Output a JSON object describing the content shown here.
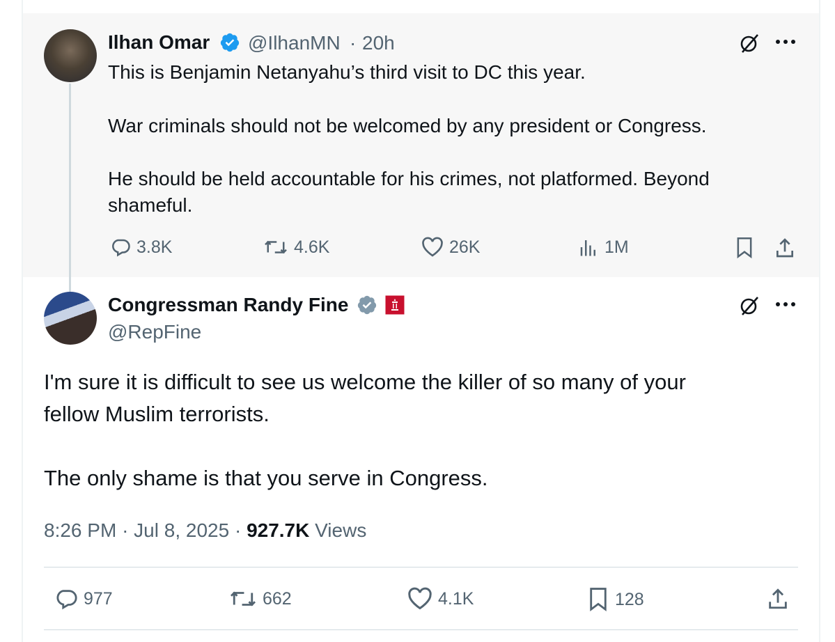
{
  "parent_tweet": {
    "author_name": "Ilhan Omar",
    "handle": "@IlhanMN",
    "separator": "·",
    "time": "20h",
    "lines": [
      "This is Benjamin Netanyahu’s third visit to DC this year.",
      "War criminals should not be welcomed by any president or Congress.",
      "He should be held accountable for his crimes, not platformed. Beyond",
      "shameful."
    ],
    "stats": {
      "replies": "3.8K",
      "reposts": "4.6K",
      "likes": "26K",
      "views": "1M"
    }
  },
  "reply_tweet": {
    "author_name": "Congressman Randy Fine",
    "handle": "@RepFine",
    "lines": [
      "I'm sure it is difficult to see us welcome the killer of so many of your",
      "fellow Muslim terrorists.",
      "The only shame is that you serve in Congress."
    ],
    "meta": {
      "time": "8:26 PM",
      "sep1": "·",
      "date": "Jul 8, 2025",
      "sep2": "·",
      "views_count": "927.7K",
      "views_label": "Views"
    },
    "stats": {
      "replies": "977",
      "reposts": "662",
      "likes": "4.1K",
      "bookmarks": "128"
    }
  },
  "icons": {
    "verified_blue": "#1d9bf0",
    "verified_gray": "#829aab",
    "affiliation_red": "#c8102e",
    "grok": "grok-icon",
    "more": "more-icon"
  }
}
